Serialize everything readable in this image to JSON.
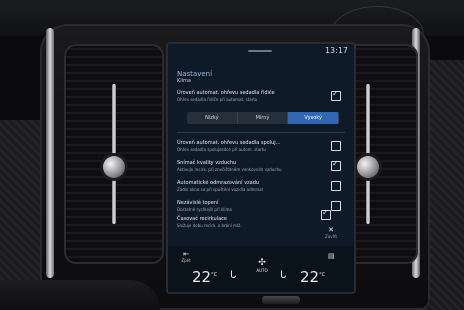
{
  "status": {
    "time": "13:17"
  },
  "panel": {
    "title": "Nastavení",
    "subtitle": "Klima"
  },
  "rows": [
    {
      "main": "Úroveň automat. ohřevu sedadla řidiče",
      "sub": "Ohřev sedadla řidiče při automat. startu",
      "checked": true
    },
    {
      "main": "Úroveň automat. ohřevu sedadla spoluj...",
      "sub": "Ohřev sedadla spolujezdce při autom. startu",
      "checked": false
    },
    {
      "main": "Snímač kvality vzduchu",
      "sub": "Aktivuje recirk. při znečištěném venkovním vzduchu",
      "checked": true
    },
    {
      "main": "Automatické odmrazování vzadu",
      "sub": "Zadní okno se při spuštění vozidla odmrazí",
      "checked": false
    },
    {
      "main": "Nezávislé topení",
      "sub": "Dostatně rychlejší při klima",
      "checked": false
    },
    {
      "main": "Časovač recirkulace",
      "sub": "Snižuje dobu recirk. a brání mlž.",
      "checked": true
    }
  ],
  "segmented": {
    "options": [
      "Nízký",
      "Mírný",
      "Vysoký"
    ],
    "selected_index": 2
  },
  "close": {
    "label": "Zavřít"
  },
  "bottom": {
    "left_label": "Zpět",
    "temp_left": "22",
    "temp_right": "22",
    "temp_unit": "°C",
    "auto_label": "AUTO"
  },
  "colors": {
    "accent": "#2f67b3",
    "screen_bg": "#0e1a28"
  }
}
